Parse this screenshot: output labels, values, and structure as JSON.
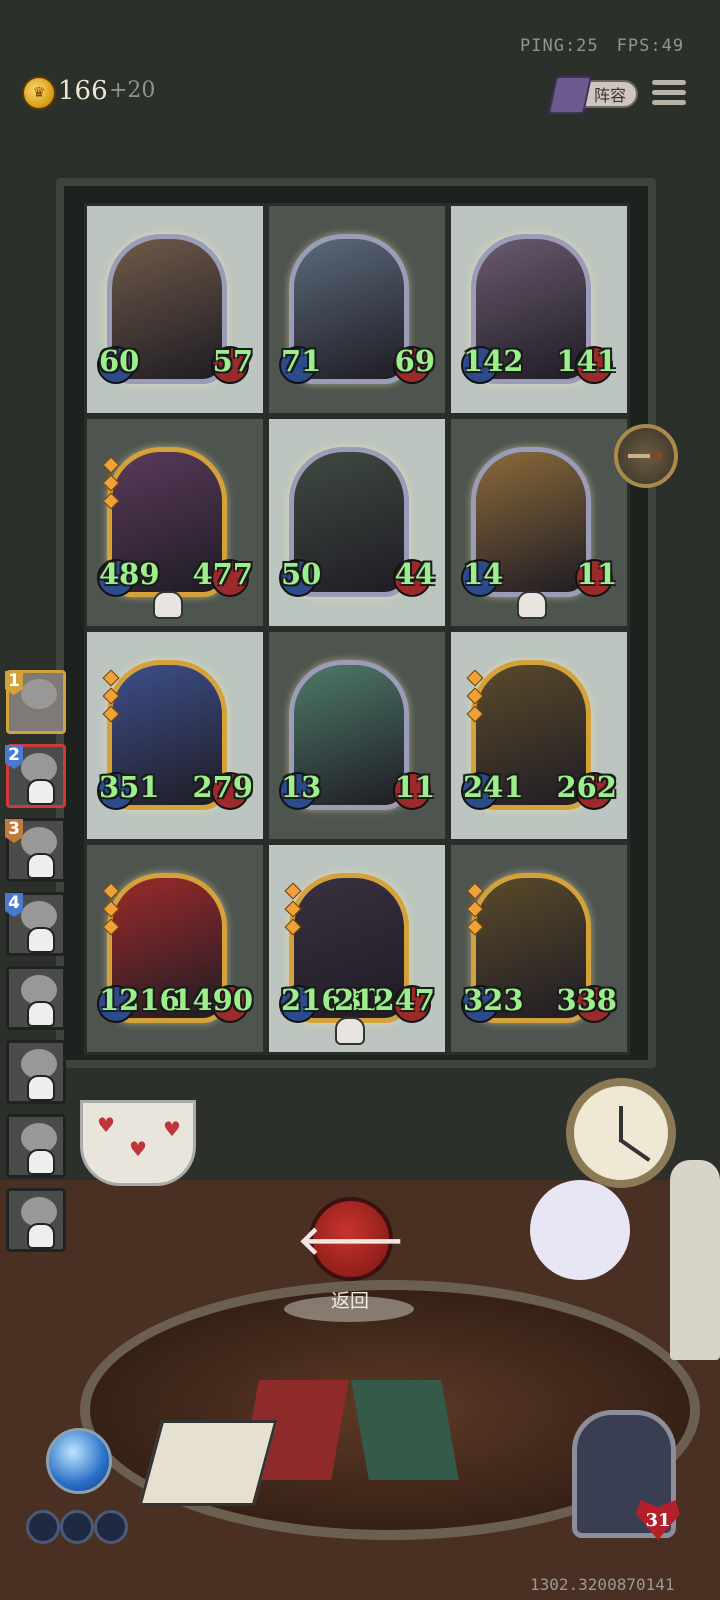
{
  "hud": {
    "ping": "PING:25",
    "fps": "FPS:49"
  },
  "currency": {
    "amount": "166",
    "bonus": "+20"
  },
  "lineup_button": "阵容",
  "board": [
    {
      "atk": "60",
      "hp": "57",
      "tone": "light",
      "frame": "silver",
      "skull": false,
      "color": "#6f5a48"
    },
    {
      "atk": "71",
      "hp": "69",
      "tone": "dark",
      "frame": "silver",
      "skull": false,
      "color": "#5b6a7a"
    },
    {
      "atk": "142",
      "hp": "141",
      "tone": "light",
      "frame": "silver",
      "skull": false,
      "color": "#6a5a6e"
    },
    {
      "atk": "489",
      "hp": "477",
      "tone": "dark",
      "frame": "gold",
      "skull": true,
      "color": "#5a3a5a"
    },
    {
      "atk": "50",
      "hp": "44",
      "tone": "light",
      "frame": "silver",
      "skull": false,
      "color": "#3f4a42"
    },
    {
      "atk": "14",
      "hp": "11",
      "tone": "dark",
      "frame": "silver",
      "skull": true,
      "color": "#8a6a3a"
    },
    {
      "atk": "351",
      "hp": "279",
      "tone": "light",
      "frame": "gold",
      "skull": false,
      "color": "#3d4f8a"
    },
    {
      "atk": "13",
      "hp": "11",
      "tone": "dark",
      "frame": "silver",
      "skull": false,
      "color": "#4e7a6a"
    },
    {
      "atk": "241",
      "hp": "262",
      "tone": "light",
      "frame": "gold",
      "skull": false,
      "color": "#5a4a2a"
    },
    {
      "atk": "1216",
      "hp": "1490",
      "tone": "dark",
      "frame": "gold",
      "skull": false,
      "color": "#9a2a2a"
    },
    {
      "atk": "21630",
      "hp": "21247",
      "tone": "light",
      "frame": "gold",
      "skull": true,
      "color": "#3a3040"
    },
    {
      "atk": "323",
      "hp": "338",
      "tone": "dark",
      "frame": "gold",
      "skull": false,
      "color": "#5a4a2a"
    }
  ],
  "queue": [
    {
      "num": "1",
      "color": "#d4a23a",
      "first": true,
      "selected": false,
      "skull": false
    },
    {
      "num": "2",
      "color": "#4a7ad0",
      "first": false,
      "selected": true,
      "skull": true
    },
    {
      "num": "3",
      "color": "#c07a3a",
      "first": false,
      "selected": false,
      "skull": true
    },
    {
      "num": "4",
      "color": "#4a7ad0",
      "first": false,
      "selected": false,
      "skull": true
    },
    {
      "num": "",
      "color": "",
      "first": false,
      "selected": false,
      "skull": true
    },
    {
      "num": "",
      "color": "",
      "first": false,
      "selected": false,
      "skull": true
    },
    {
      "num": "",
      "color": "",
      "first": false,
      "selected": false,
      "skull": true
    },
    {
      "num": "",
      "color": "",
      "first": false,
      "selected": false,
      "skull": true
    }
  ],
  "return_button": {
    "label": "返回",
    "icon": "arrow-left-icon"
  },
  "player": {
    "hp": "31"
  },
  "version": "1302.3200870141"
}
